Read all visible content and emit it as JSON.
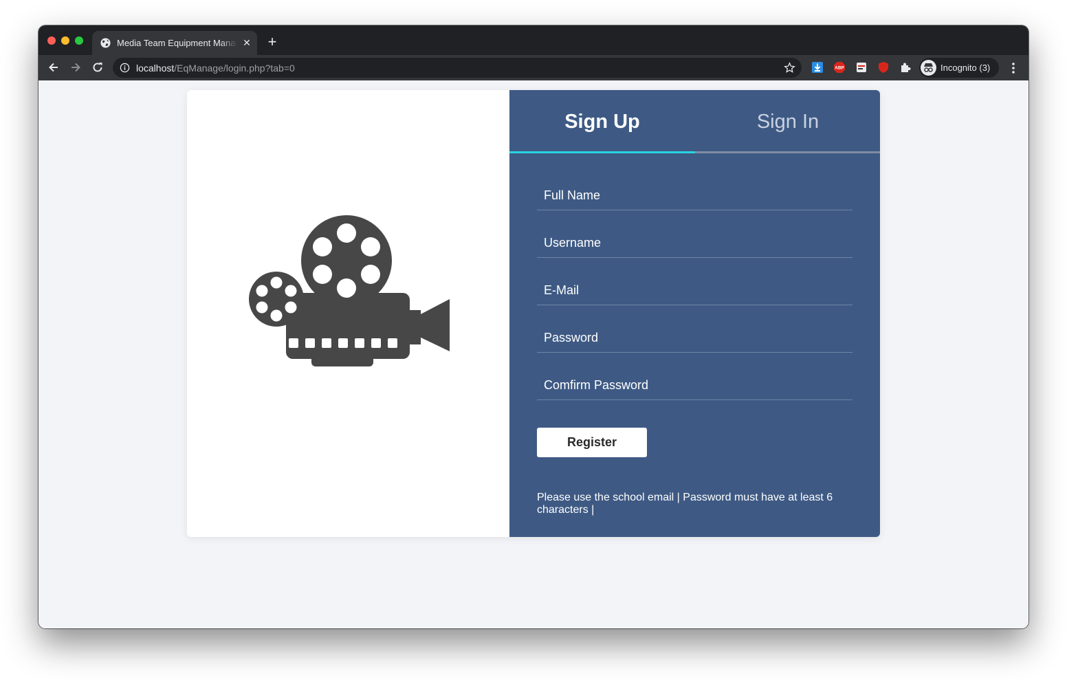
{
  "browser": {
    "tab_title": "Media Team Equipment Management",
    "url_host": "localhost",
    "url_path": "/EqManage/login.php?tab=0",
    "incognito_label": "Incognito (3)",
    "ext_abp_label": "ABP",
    "new_tab_symbol": "+",
    "tab_close_symbol": "✕"
  },
  "auth": {
    "tabs": [
      {
        "label": "Sign Up",
        "active": true
      },
      {
        "label": "Sign In",
        "active": false
      }
    ],
    "fields": {
      "full_name": "Full Name",
      "username": "Username",
      "email": "E-Mail",
      "password": "Password",
      "confirm_password": "Comfirm Password"
    },
    "register_label": "Register",
    "hint": "Please use the school email | Password must have at least 6 characters |"
  },
  "colors": {
    "panel_bg": "#3e5a84",
    "tab_accent": "#29d4e0",
    "page_bg": "#f3f4f8"
  },
  "icons": {
    "illustration": "movie-camera-icon"
  }
}
